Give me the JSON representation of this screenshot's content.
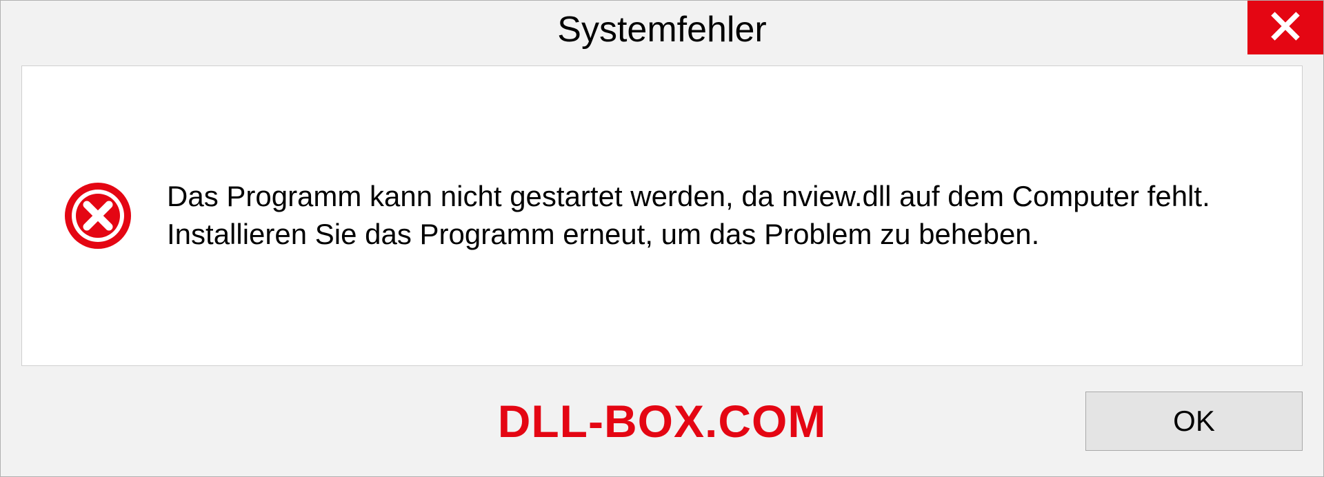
{
  "dialog": {
    "title": "Systemfehler",
    "message": "Das Programm kann nicht gestartet werden, da nview.dll auf dem Computer fehlt. Installieren Sie das Programm erneut, um das Problem zu beheben.",
    "ok_label": "OK"
  },
  "watermark": "DLL-BOX.COM",
  "colors": {
    "error_red": "#e40613",
    "panel_bg": "#ffffff",
    "dialog_bg": "#f2f2f2"
  }
}
